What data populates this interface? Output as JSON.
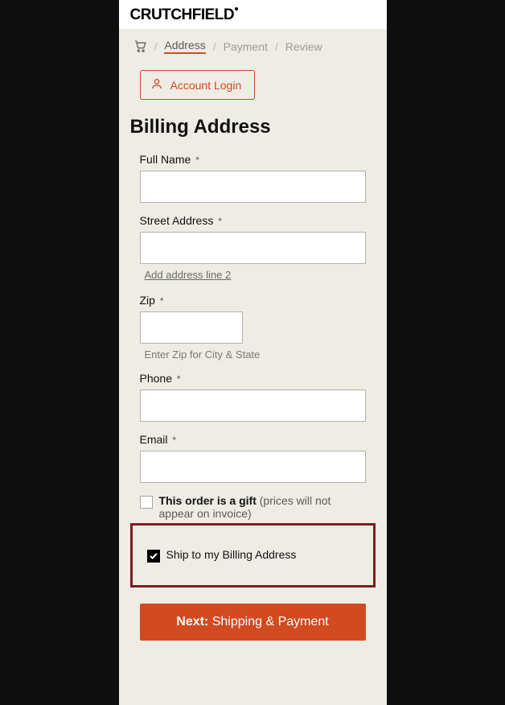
{
  "logo": "CRUTCHFIELD",
  "breadcrumb": {
    "address": "Address",
    "payment": "Payment",
    "review": "Review"
  },
  "accountLogin": "Account Login",
  "pageTitle": "Billing Address",
  "labels": {
    "fullName": "Full Name",
    "street": "Street Address",
    "zip": "Zip",
    "phone": "Phone",
    "email": "Email"
  },
  "required": "*",
  "addLine2": "Add address line 2",
  "zipHelp": "Enter Zip for City & State",
  "gift": {
    "bold": "This order is a gift",
    "light": "(prices will not appear on invoice)"
  },
  "shipToBilling": "Ship to my Billing Address",
  "next": {
    "bold": "Next:",
    "rest": "Shipping & Payment"
  },
  "values": {
    "fullName": "",
    "street": "",
    "zip": "",
    "phone": "",
    "email": ""
  }
}
